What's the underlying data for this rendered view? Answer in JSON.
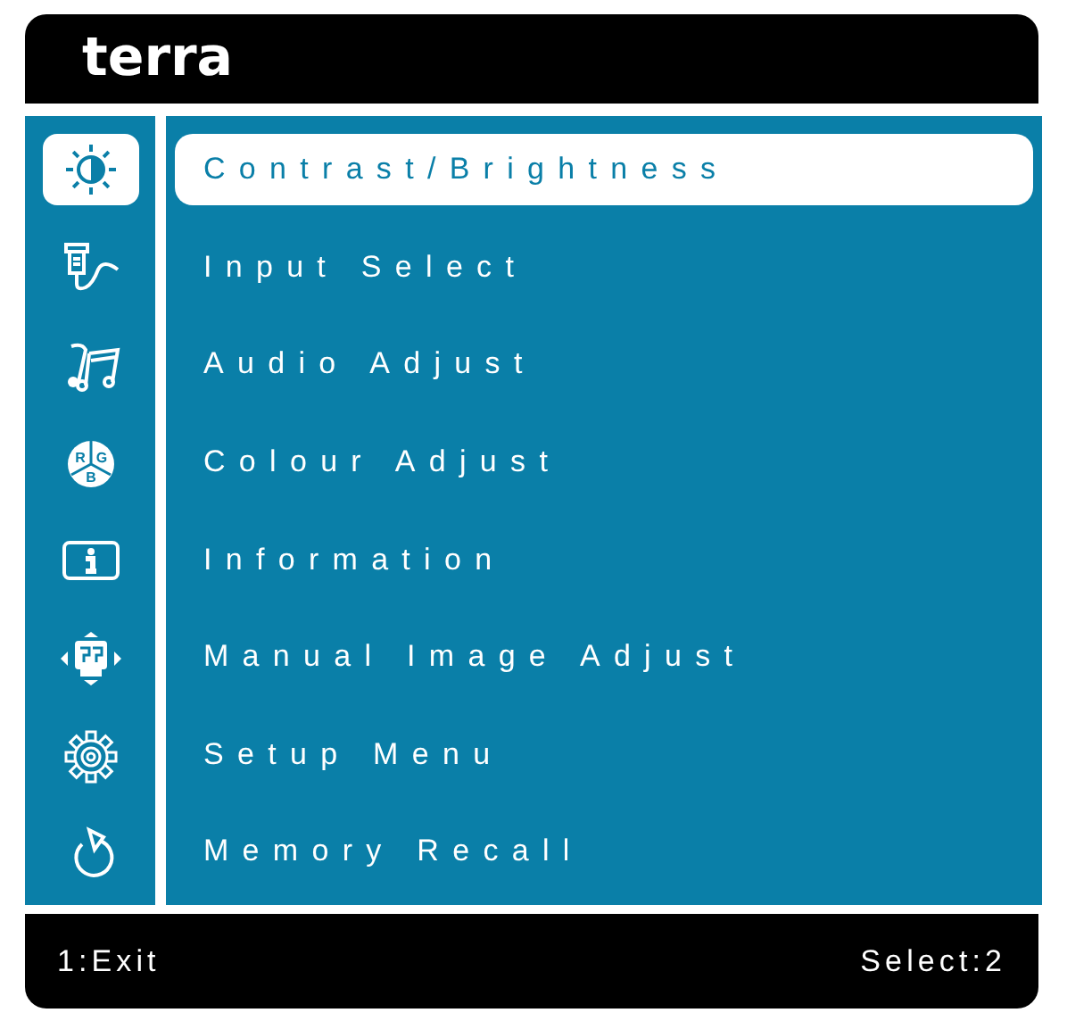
{
  "header": {
    "logo": "terra"
  },
  "menu": [
    {
      "label": "Contrast/Brightness",
      "selected": true
    },
    {
      "label": "Input Select",
      "selected": false
    },
    {
      "label": "Audio Adjust",
      "selected": false
    },
    {
      "label": "Colour Adjust",
      "icon_text": [
        "R",
        "G",
        "B"
      ],
      "selected": false
    },
    {
      "label": "Information",
      "selected": false
    },
    {
      "label": "Manual Image Adjust",
      "selected": false
    },
    {
      "label": "Setup Menu",
      "selected": false
    },
    {
      "label": "Memory Recall",
      "selected": false
    }
  ],
  "footer": {
    "left": "1:Exit",
    "right": "Select:2"
  }
}
